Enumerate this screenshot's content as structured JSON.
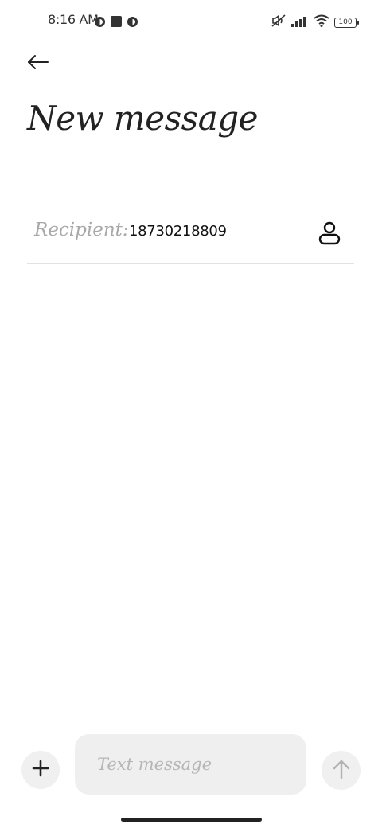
{
  "status_bar": {
    "time": "8:16 AM",
    "left_icons": [
      "notification-circle-icon",
      "notification-square-icon",
      "notification-circle-icon"
    ],
    "right_icons": [
      "mute-icon",
      "signal-icon",
      "wifi-icon",
      "battery-icon"
    ],
    "battery_level": "100"
  },
  "header": {
    "back_icon": "arrow-left-icon",
    "title": "New message"
  },
  "recipient": {
    "label": "Recipient:",
    "value": "18730218809",
    "contact_icon": "contact-person-icon"
  },
  "composer": {
    "add_icon": "plus-icon",
    "placeholder": "Text message",
    "value": "",
    "send_icon": "arrow-up-icon"
  },
  "colors": {
    "background": "#ffffff",
    "field_background": "#efefef",
    "label_gray": "#a8a8a8",
    "text_dark": "#111111"
  }
}
